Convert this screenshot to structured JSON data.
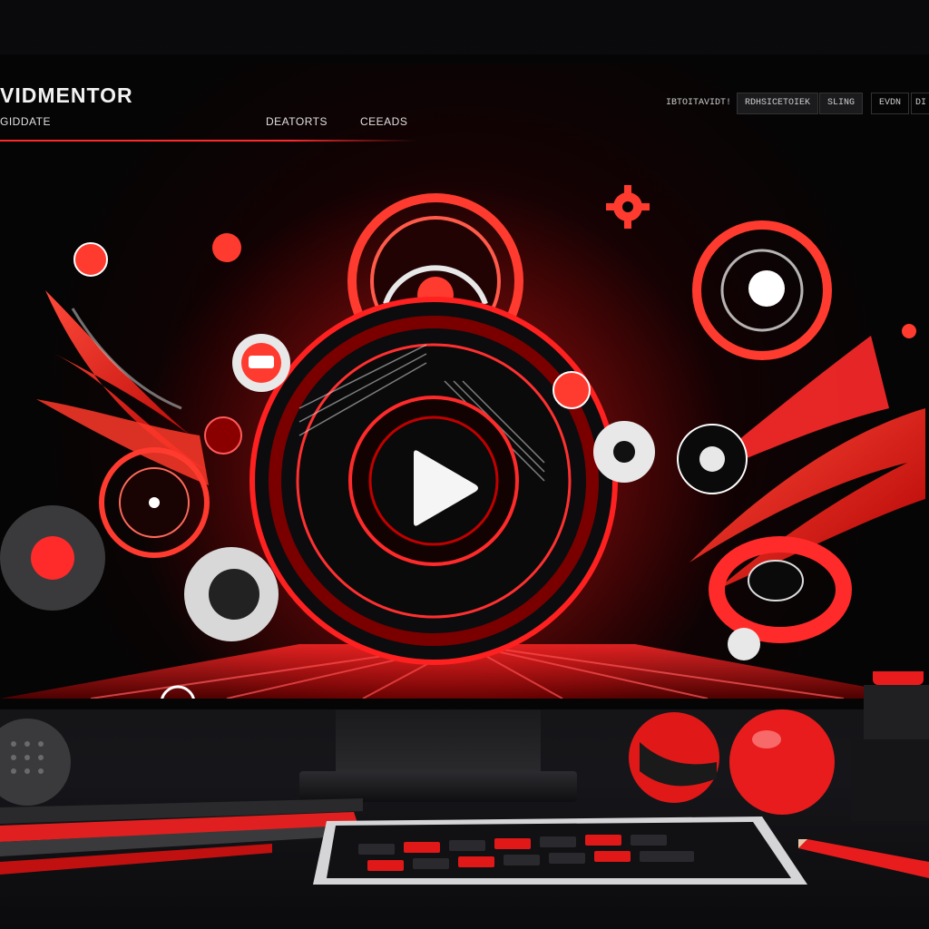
{
  "header": {
    "logo": "VIDMENTOR",
    "sub_link": "GIDDATE",
    "nav_links": [
      "DEATORTS",
      "CEEADS"
    ],
    "buttons": [
      "IBTOITAVIDT!",
      "RDHSICETOIEK",
      "SLING",
      "EVDN",
      "DI"
    ]
  },
  "hero": {
    "play_icon": "play-icon",
    "decor_icon": "gear-icon"
  },
  "colors": {
    "accent": "#ff2020",
    "dark_accent": "#8a0000",
    "background": "#050505",
    "text": "#f2f2f2"
  }
}
